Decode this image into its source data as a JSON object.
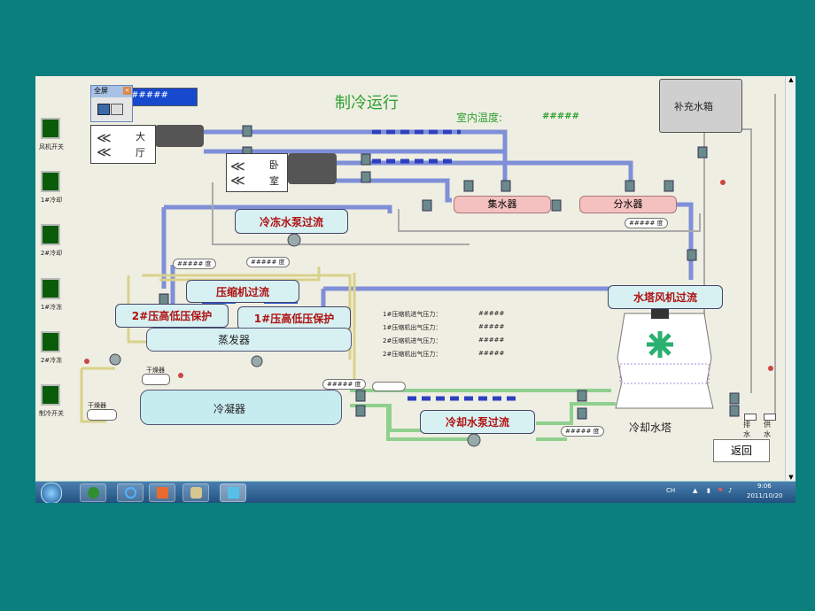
{
  "title": "制冷运行",
  "indoor_temp": {
    "label": "室内温度:",
    "value": "#####"
  },
  "top_readout": "#####",
  "popup": {
    "title": "全屏"
  },
  "sidebar": [
    {
      "label": "风机开关"
    },
    {
      "label": "1#冷却"
    },
    {
      "label": "2#冷却"
    },
    {
      "label": "1#冷冻"
    },
    {
      "label": "2#冷冻"
    },
    {
      "label": "制冷开关"
    }
  ],
  "rooms": {
    "hall_1": "大",
    "hall_2": "厅",
    "bed_1": "卧",
    "bed_2": "室"
  },
  "refill_tank": "补充水箱",
  "collector": "集水器",
  "distributor": "分水器",
  "panels": {
    "chilled_pump": "冷冻水泵过流",
    "compressor": "压缩机过流",
    "prot2": "2#压高低压保护",
    "prot1": "1#压高低压保护",
    "tower_fan": "水塔风机过流",
    "cooling_pump": "冷却水泵过流"
  },
  "evaporator": "蒸发器",
  "condenser": "冷凝器",
  "dryer1": "干燥器",
  "dryer2": "干燥器",
  "cooling_tower": "冷却水塔",
  "temps": {
    "t1": "##### 度",
    "t2": "##### 度",
    "t3": "##### 度",
    "t4": "##### 度",
    "t5": "##### 度"
  },
  "pressures": [
    {
      "label": "1#压缩机进气压力：",
      "value": "#####"
    },
    {
      "label": "1#压缩机出气压力：",
      "value": "#####"
    },
    {
      "label": "2#压缩机进气压力：",
      "value": "#####"
    },
    {
      "label": "2#压缩机出气压力：",
      "value": "#####"
    }
  ],
  "drain": {
    "a": "排",
    "b": "水"
  },
  "supply": {
    "a": "供",
    "b": "水"
  },
  "back_button": "返回",
  "tray": {
    "lang": "CH",
    "time": "9:06",
    "date": "2011/10/20"
  },
  "colors": {
    "teal_bg": "#0a7f7e",
    "pipe_chilled": "#7f8fd8",
    "pipe_cooling": "#8fd08f",
    "pipe_yellow": "#d8d28a",
    "panel": "#d7f1f3"
  }
}
